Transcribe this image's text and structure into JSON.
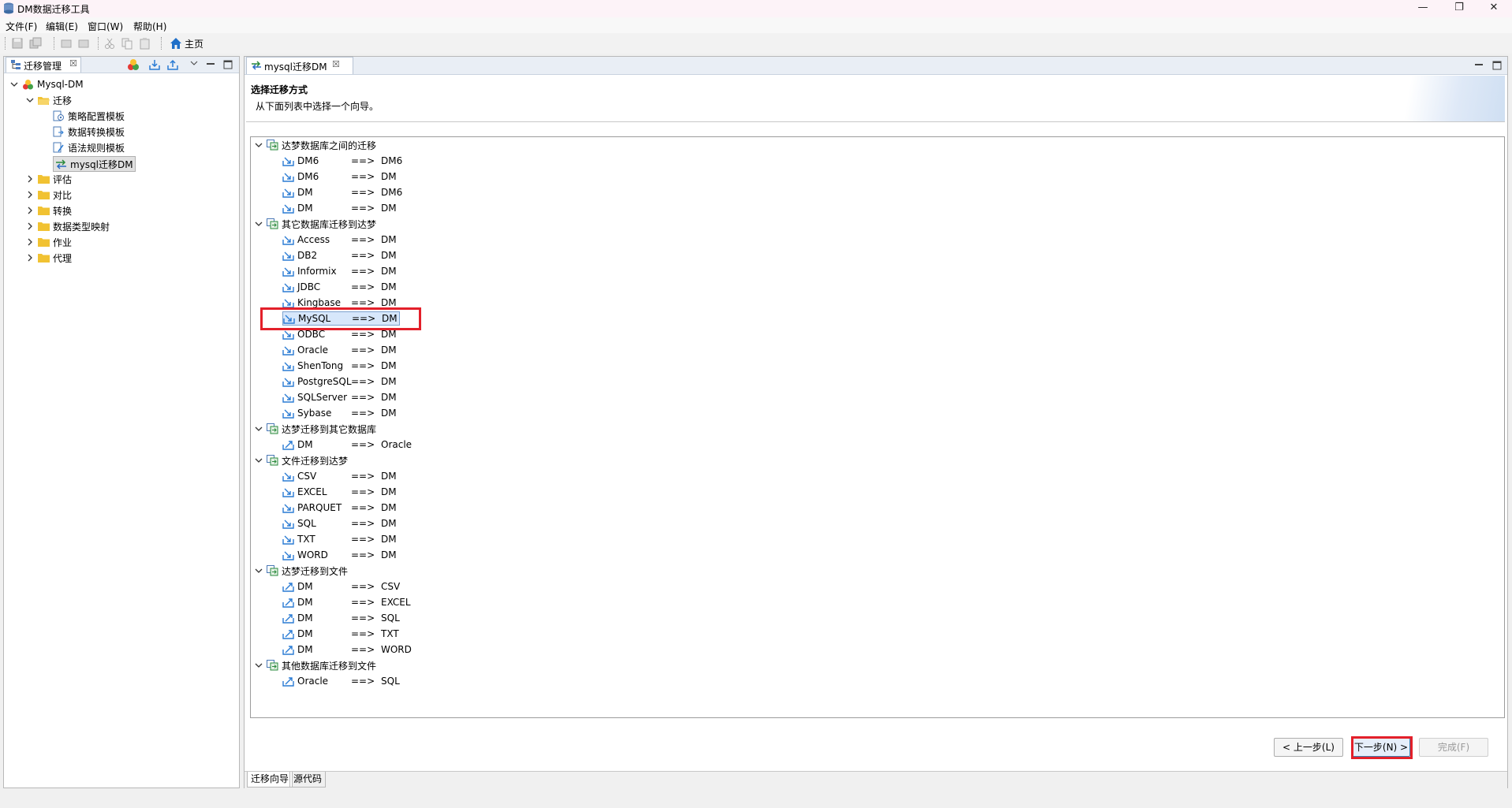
{
  "window": {
    "title": "DM数据迁移工具",
    "minimize": "—",
    "restore": "❐",
    "close": "✕"
  },
  "menu": [
    "文件(F)",
    "编辑(E)",
    "窗口(W)",
    "帮助(H)"
  ],
  "toolbar": {
    "home_label": "主页"
  },
  "left_panel": {
    "tab_label": "迁移管理",
    "tree": {
      "root": "Mysql-DM",
      "migration_folder": "迁移",
      "children": [
        "策略配置模板",
        "数据转换模板",
        "语法规则模板",
        "mysql迁移DM"
      ],
      "folders": [
        "评估",
        "对比",
        "转换",
        "数据类型映射",
        "作业",
        "代理"
      ]
    }
  },
  "editor": {
    "tab_label": "mysql迁移DM",
    "wizard_title": "选择迁移方式",
    "wizard_desc": "从下面列表中选择一个向导。",
    "arrow": "==>",
    "categories": [
      {
        "label": "达梦数据库之间的迁移",
        "items": [
          [
            "DM6",
            "DM6"
          ],
          [
            "DM6",
            "DM"
          ],
          [
            "DM",
            "DM6"
          ],
          [
            "DM",
            "DM"
          ]
        ]
      },
      {
        "label": "其它数据库迁移到达梦",
        "items": [
          [
            "Access",
            "DM"
          ],
          [
            "DB2",
            "DM"
          ],
          [
            "Informix",
            "DM"
          ],
          [
            "JDBC",
            "DM"
          ],
          [
            "Kingbase",
            "DM"
          ],
          [
            "MySQL",
            "DM"
          ],
          [
            "ODBC",
            "DM"
          ],
          [
            "Oracle",
            "DM"
          ],
          [
            "ShenTong",
            "DM"
          ],
          [
            "PostgreSQL",
            "DM"
          ],
          [
            "SQLServer",
            "DM"
          ],
          [
            "Sybase",
            "DM"
          ]
        ]
      },
      {
        "label": "达梦迁移到其它数据库",
        "items": [
          [
            "DM",
            "Oracle"
          ]
        ]
      },
      {
        "label": "文件迁移到达梦",
        "items": [
          [
            "CSV",
            "DM"
          ],
          [
            "EXCEL",
            "DM"
          ],
          [
            "PARQUET",
            "DM"
          ],
          [
            "SQL",
            "DM"
          ],
          [
            "TXT",
            "DM"
          ],
          [
            "WORD",
            "DM"
          ]
        ]
      },
      {
        "label": "达梦迁移到文件",
        "items": [
          [
            "DM",
            "CSV"
          ],
          [
            "DM",
            "EXCEL"
          ],
          [
            "DM",
            "SQL"
          ],
          [
            "DM",
            "TXT"
          ],
          [
            "DM",
            "WORD"
          ]
        ]
      },
      {
        "label": "其他数据库迁移到文件",
        "items": [
          [
            "Oracle",
            "SQL"
          ]
        ]
      }
    ],
    "buttons": {
      "back": "< 上一步(L)",
      "next": "下一步(N) >",
      "finish": "完成(F)"
    },
    "bottom_tabs": [
      "迁移向导",
      "源代码"
    ]
  },
  "colors": {
    "highlight": "#e3202a",
    "folder": "#f1c232",
    "selection": "#d7e7fb"
  }
}
